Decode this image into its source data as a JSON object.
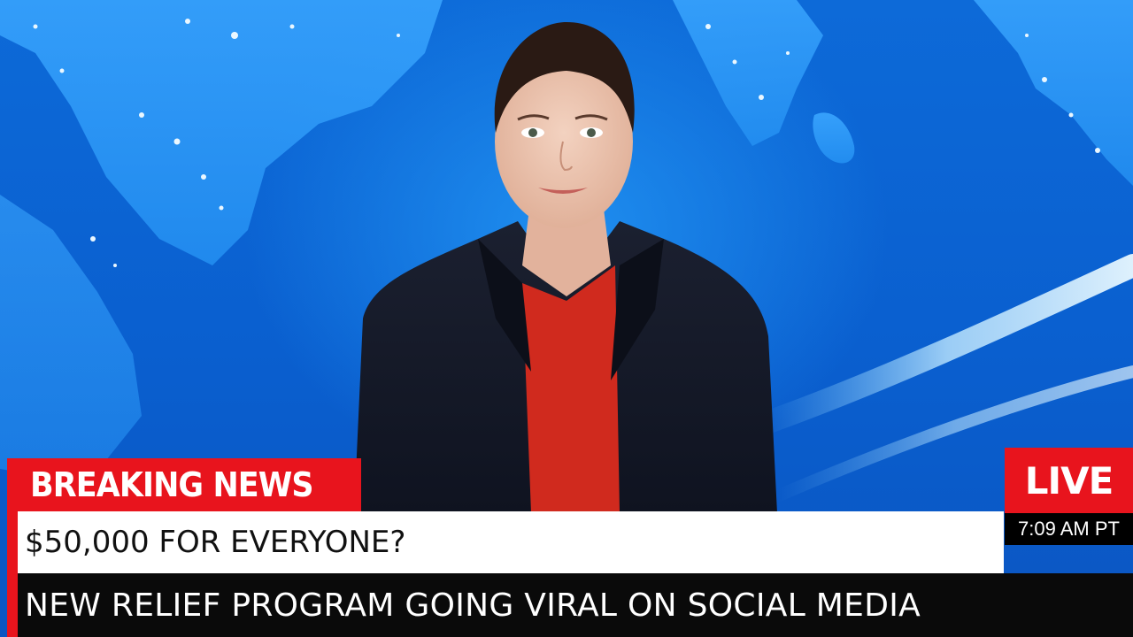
{
  "lower_third": {
    "tag": "BREAKING NEWS",
    "headline": "$50,000 FOR EVERYONE?",
    "subheadline": "NEW RELIEF PROGRAM GOING VIRAL ON SOCIAL MEDIA",
    "live_label": "LIVE",
    "time": "7:09 AM PT"
  },
  "colors": {
    "accent_red": "#e8141d",
    "backdrop_blue": "#0d6ad8",
    "headline_bg": "#ffffff",
    "subheadline_bg": "#0a0a0a"
  }
}
